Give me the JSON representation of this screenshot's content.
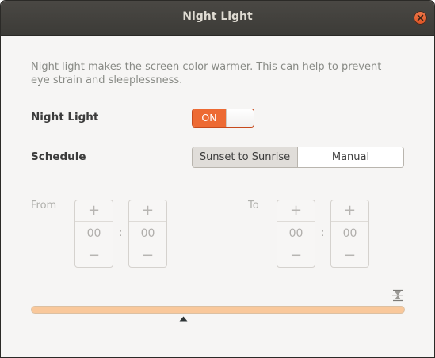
{
  "window": {
    "title": "Night Light"
  },
  "description": "Night light makes the screen color warmer. This can help to prevent eye strain and sleeplessness.",
  "night_light": {
    "label": "Night Light",
    "switch_text": "ON",
    "enabled": true
  },
  "schedule": {
    "label": "Schedule",
    "options": [
      "Sunset to Sunrise",
      "Manual"
    ],
    "selected": "Sunset to Sunrise"
  },
  "from": {
    "label": "From",
    "hours": "00",
    "minutes": "00",
    "separator": ":"
  },
  "to": {
    "label": "To",
    "hours": "00",
    "minutes": "00",
    "separator": ":"
  },
  "spin": {
    "plus": "+",
    "minus": "−"
  },
  "colors": {
    "accent": "#ed6a33",
    "titlebar": "#3c3b37",
    "slider": "#f9c89b"
  },
  "icons": {
    "close": "close-icon",
    "temperature": "color-temperature-icon",
    "slider_mark": "slider-mark-icon"
  }
}
